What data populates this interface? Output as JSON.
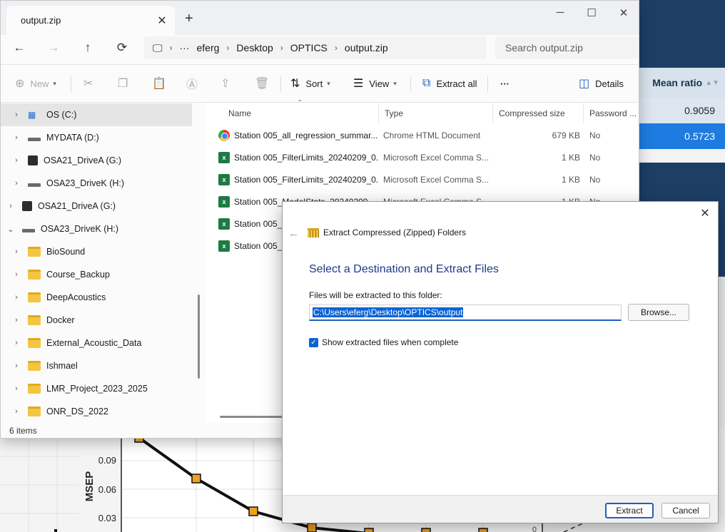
{
  "background": {
    "table": {
      "header": "Mean ratio",
      "rows": [
        "0.9059",
        "0.5723"
      ]
    },
    "plot": {
      "ylabel": "MSEP",
      "yticks": [
        "0.09",
        "0.06",
        "0.03"
      ],
      "right_tick": "0"
    }
  },
  "explorer": {
    "tab_title": "output.zip",
    "close_tab_glyph": "✕",
    "new_tab_glyph": "+",
    "window_controls": [
      "─",
      "☐",
      "✕"
    ],
    "nav": {
      "back": "←",
      "forward": "→",
      "up": "↑",
      "refresh": "⟳",
      "pc": "🖵"
    },
    "breadcrumb": [
      "eferg",
      "Desktop",
      "OPTICS",
      "output.zip"
    ],
    "breadcrumb_more": "···",
    "breadcrumb_sep": "›",
    "search_placeholder": "Search output.zip",
    "toolbar": {
      "new": "New",
      "sort": "Sort",
      "view": "View",
      "extract_all": "Extract all",
      "more": "···",
      "details": "Details"
    },
    "nav_items": [
      {
        "label": "OS (C:)",
        "kind": "win"
      },
      {
        "label": "MYDATA (D:)",
        "kind": "drive"
      },
      {
        "label": "OSA21_DriveA (G:)",
        "kind": "osa"
      },
      {
        "label": "OSA23_DriveK (H:)",
        "kind": "drive"
      },
      {
        "label": "OSA21_DriveA (G:)",
        "kind": "osa"
      },
      {
        "label": "OSA23_DriveK (H:)",
        "kind": "drive"
      },
      {
        "label": "BioSound",
        "kind": "folder"
      },
      {
        "label": "Course_Backup",
        "kind": "folder"
      },
      {
        "label": "DeepAcoustics",
        "kind": "folder"
      },
      {
        "label": "Docker",
        "kind": "folder"
      },
      {
        "label": "External_Acoustic_Data",
        "kind": "folder"
      },
      {
        "label": "Ishmael",
        "kind": "folder"
      },
      {
        "label": "LMR_Project_2023_2025",
        "kind": "folder"
      },
      {
        "label": "ONR_DS_2022",
        "kind": "folder"
      }
    ],
    "columns": [
      "Name",
      "Type",
      "Compressed size",
      "Password ..."
    ],
    "files": [
      {
        "name": "Station 005_all_regression_summar...",
        "type": "Chrome HTML Document",
        "size": "679 KB",
        "pw": "No",
        "icon": "chrome"
      },
      {
        "name": "Station 005_FilterLimits_20240209_0...",
        "type": "Microsoft Excel Comma S...",
        "size": "1 KB",
        "pw": "No",
        "icon": "excel"
      },
      {
        "name": "Station 005_FilterLimits_20240209_0...",
        "type": "Microsoft Excel Comma S...",
        "size": "1 KB",
        "pw": "No",
        "icon": "excel"
      },
      {
        "name": "Station 005_ModelStats_20240209...",
        "type": "Microsoft Excel Comma S...",
        "size": "1 KB",
        "pw": "No",
        "icon": "excel"
      },
      {
        "name": "Station 005_R",
        "type": "",
        "size": "",
        "pw": "",
        "icon": "excel"
      },
      {
        "name": "Station 005_R",
        "type": "",
        "size": "",
        "pw": "",
        "icon": "excel"
      }
    ],
    "status": "6 items"
  },
  "dialog": {
    "title": "Extract Compressed (Zipped) Folders",
    "heading": "Select a Destination and Extract Files",
    "label": "Files will be extracted to this folder:",
    "path": "C:\\Users\\eferg\\Desktop\\OPTICS\\output",
    "browse": "Browse...",
    "checkbox_label": "Show extracted files when complete",
    "checkbox_checked": true,
    "extract": "Extract",
    "cancel": "Cancel",
    "close_glyph": "✕",
    "back_glyph": "←"
  },
  "colors": {
    "accent": "#1f5fbf",
    "navy": "#1d3f66",
    "highlight_row": "#1e7be0"
  }
}
